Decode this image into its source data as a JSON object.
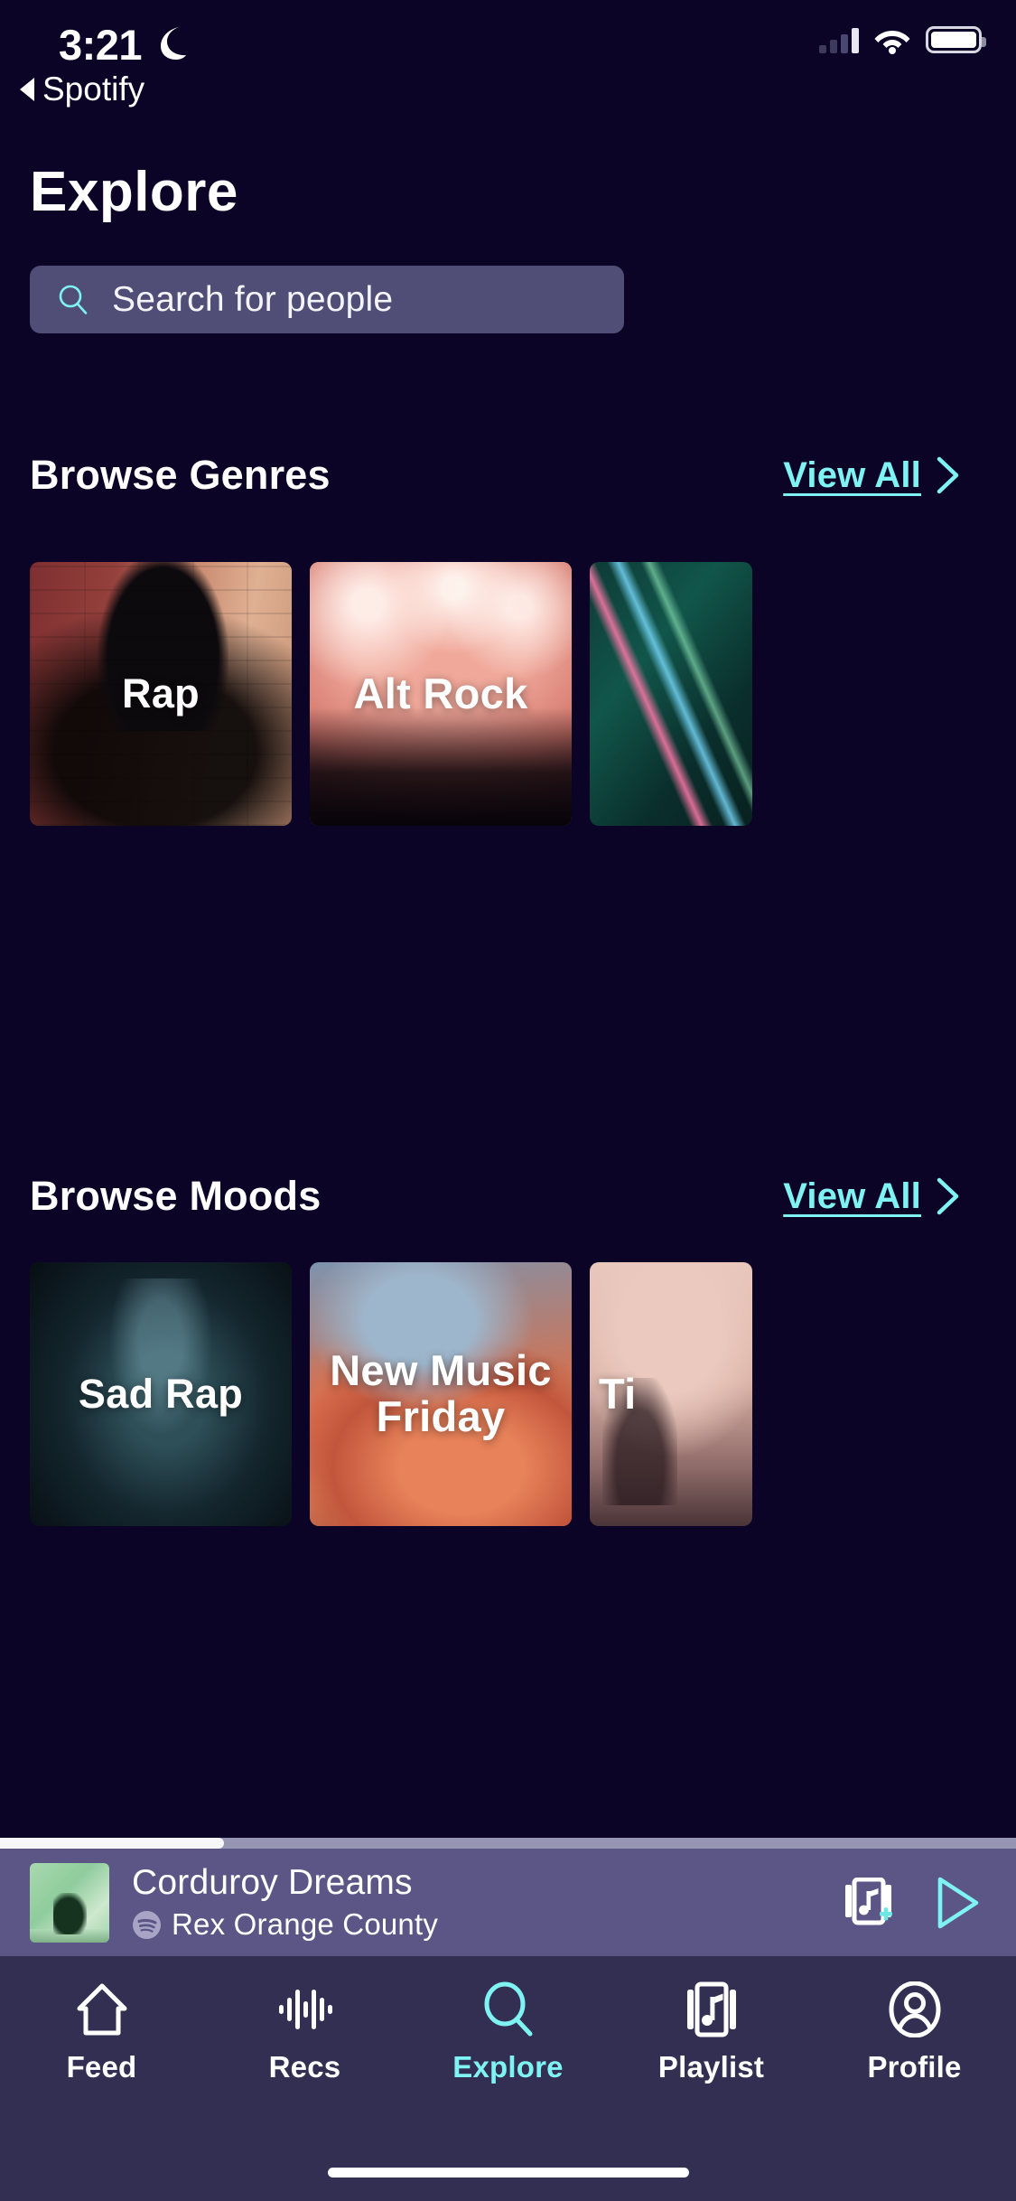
{
  "status_bar": {
    "time": "3:21",
    "dnd_icon": "moon-icon",
    "back_label": "Spotify",
    "signal_icon": "cellular-signal-icon",
    "wifi_icon": "wifi-icon",
    "battery_icon": "battery-icon"
  },
  "header": {
    "title": "Explore"
  },
  "search": {
    "placeholder": "Search for people",
    "icon": "search-icon",
    "value": ""
  },
  "sections": [
    {
      "title": "Browse Genres",
      "view_all_label": "View All",
      "chevron_icon": "chevron-right-icon",
      "cards": [
        {
          "label": "Rap",
          "art": "art-rap"
        },
        {
          "label": "Alt Rock",
          "art": "art-altrock"
        },
        {
          "label": "",
          "art": "art-teal"
        }
      ]
    },
    {
      "title": "Browse Moods",
      "view_all_label": "View All",
      "chevron_icon": "chevron-right-icon",
      "cards": [
        {
          "label": "Sad Rap",
          "art": "art-sadrap"
        },
        {
          "label": "New Music Friday",
          "art": "art-nmf"
        },
        {
          "label": "Ti",
          "art": "art-tiktok"
        }
      ]
    }
  ],
  "now_playing": {
    "title": "Corduroy Dreams",
    "artist": "Rex Orange County",
    "source_icon": "spotify-logo-icon",
    "album_art": "album-art-thumbnail",
    "progress_percent": 22,
    "add_to_playlist_icon": "add-to-playlist-icon",
    "play_icon": "play-icon"
  },
  "tab_bar": {
    "active": "Explore",
    "items": [
      {
        "label": "Feed",
        "icon": "home-icon"
      },
      {
        "label": "Recs",
        "icon": "waveform-icon"
      },
      {
        "label": "Explore",
        "icon": "search-icon"
      },
      {
        "label": "Playlist",
        "icon": "music-note-card-icon"
      },
      {
        "label": "Profile",
        "icon": "person-circle-icon"
      }
    ]
  },
  "colors": {
    "background": "#0B0426",
    "accent": "#7FF3F3",
    "search_field": "#504D76",
    "now_playing_bar": "#5B5686",
    "tab_bar": "#332F52"
  }
}
